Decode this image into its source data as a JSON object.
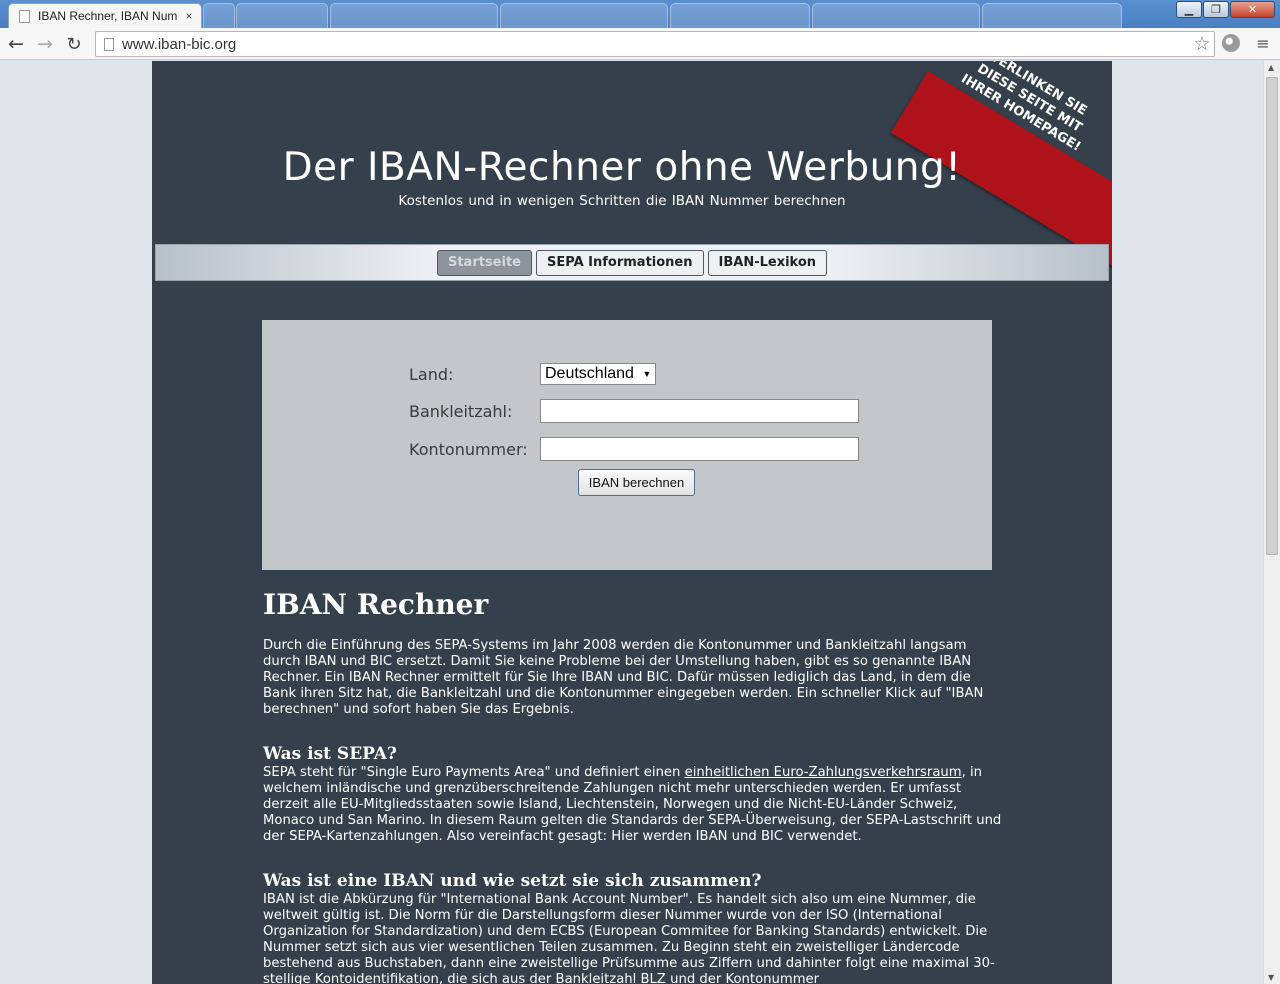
{
  "browser": {
    "active_tab_title": "IBAN Rechner, IBAN Num",
    "tab_close": "×",
    "background_tabs": [
      "",
      "",
      "",
      "",
      "",
      "",
      ""
    ],
    "url": "www.iban-bic.org",
    "window_controls": {
      "minimize": "▁",
      "maximize": "❐",
      "close": "✕"
    }
  },
  "ribbon": {
    "text": "VERLINKEN SIE DIESE SEITE MIT IHRER HOMEPAGE!",
    "color": "#b0121a"
  },
  "header": {
    "title": "Der IBAN-Rechner ohne Werbung!",
    "subtitle": "Kostenlos und in wenigen Schritten die IBAN Nummer berechnen"
  },
  "nav": {
    "items": [
      {
        "label": "Startseite",
        "active": true
      },
      {
        "label": "SEPA Informationen",
        "active": false
      },
      {
        "label": "IBAN-Lexikon",
        "active": false
      }
    ]
  },
  "form": {
    "country_label": "Land:",
    "country_value": "Deutschland",
    "bank_code_label": "Bankleitzahl:",
    "bank_code_value": "",
    "account_label": "Kontonummer:",
    "account_value": "",
    "submit_label": "IBAN berechnen"
  },
  "content": {
    "heading": "IBAN Rechner",
    "intro": "Durch die Einführung des SEPA-Systems im Jahr 2008 werden die Kontonummer und Bankleitzahl langsam durch IBAN und BIC ersetzt. Damit Sie keine Probleme bei der Umstellung haben, gibt es so genannte IBAN Rechner. Ein IBAN Rechner ermittelt für Sie Ihre IBAN und BIC. Dafür müssen lediglich das Land, in dem die Bank ihren Sitz hat, die Bankleitzahl und die Kontonummer eingegeben werden. Ein schneller Klick auf \"IBAN berechnen\" und sofort haben Sie das Ergebnis.",
    "sepa_heading": "Was ist SEPA?",
    "sepa_text_before": "SEPA steht für \"Single Euro Payments Area\" und definiert einen ",
    "sepa_link": "einheitlichen Euro-Zahlungsverkehrsraum",
    "sepa_text_after": ", in welchem inländische und grenzüberschreitende Zahlungen nicht mehr unterschieden werden. Er umfasst derzeit alle EU-Mitgliedsstaaten sowie Island, Liechtenstein, Norwegen und die Nicht-EU-Länder Schweiz, Monaco und San Marino. In diesem Raum gelten die Standards der SEPA-Überweisung, der SEPA-Lastschrift und der SEPA-Kartenzahlungen. Also vereinfacht gesagt: Hier werden IBAN und BIC verwendet.",
    "iban_heading": "Was ist eine IBAN und wie setzt sie sich zusammen?",
    "iban_text": "IBAN ist die Abkürzung für \"International Bank Account Number\". Es handelt sich also um eine Nummer, die weltweit gültig ist. Die Norm für die Darstellungsform dieser Nummer wurde von der ISO (International Organization for Standardization) und dem ECBS (European Commitee for Banking Standards) entwickelt. Die Nummer setzt sich aus vier wesentlichen Teilen zusammen. Zu Beginn steht ein zweistelliger Ländercode bestehend aus Buchstaben, dann eine zweistellige Prüfsumme aus Ziffern und dahinter folgt eine maximal 30-stellige Kontoidentifikation, die sich aus der Bankleitzahl BLZ und der Kontonummer"
  },
  "colors": {
    "page_background": "#36404c",
    "form_panel": "#c4c7c9",
    "viewport_background": "#dfe3ea"
  }
}
